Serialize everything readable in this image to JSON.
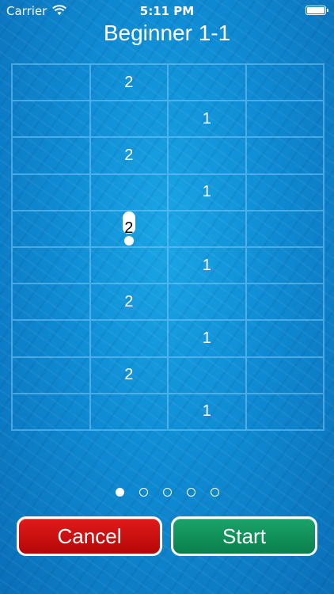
{
  "status_bar": {
    "carrier": "Carrier",
    "time": "5:11 PM"
  },
  "title": "Beginner 1-1",
  "grid": {
    "columns": 4,
    "rows": [
      [
        "",
        "2",
        "",
        ""
      ],
      [
        "",
        "",
        "1",
        ""
      ],
      [
        "",
        "2",
        "",
        ""
      ],
      [
        "",
        "",
        "1",
        ""
      ],
      [
        "",
        "2",
        "",
        ""
      ],
      [
        "",
        "",
        "1",
        ""
      ],
      [
        "",
        "2",
        "",
        ""
      ],
      [
        "",
        "",
        "1",
        ""
      ],
      [
        "",
        "2",
        "",
        ""
      ],
      [
        "",
        "",
        "1",
        ""
      ]
    ],
    "footprint_cell": {
      "row": 4,
      "col": 1
    }
  },
  "page_indicator": {
    "count": 5,
    "active": 0
  },
  "buttons": {
    "cancel": "Cancel",
    "start": "Start"
  }
}
